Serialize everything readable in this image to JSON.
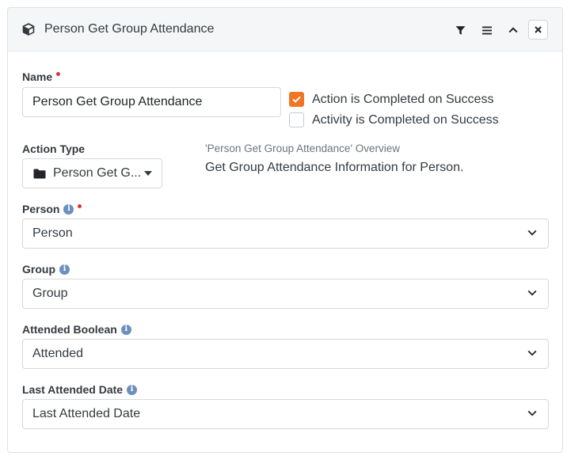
{
  "header": {
    "title": "Person Get Group Attendance",
    "icons": [
      "cube-icon",
      "filter-icon",
      "menu-icon",
      "chevron-up-icon",
      "close-icon"
    ]
  },
  "name_field": {
    "label": "Name",
    "value": "Person Get Group Attendance",
    "required": true
  },
  "checkboxes": [
    {
      "label": "Action is Completed on Success",
      "checked": true
    },
    {
      "label": "Activity is Completed on Success",
      "checked": false
    }
  ],
  "action_type": {
    "label": "Action Type",
    "selected": "Person Get G...",
    "icon": "folder-icon"
  },
  "overview": {
    "title": "'Person Get Group Attendance' Overview",
    "text": "Get Group Attendance Information for Person."
  },
  "fields": {
    "person": {
      "label": "Person",
      "value": "Person",
      "required": true
    },
    "group": {
      "label": "Group",
      "value": "Group"
    },
    "attended_boolean": {
      "label": "Attended Boolean",
      "value": "Attended"
    },
    "last_attended_date": {
      "label": "Last Attended Date",
      "value": "Last Attended Date"
    }
  },
  "colors": {
    "accent": "#ee7625",
    "required": "#dd3333",
    "info": "#6c8fbf"
  }
}
